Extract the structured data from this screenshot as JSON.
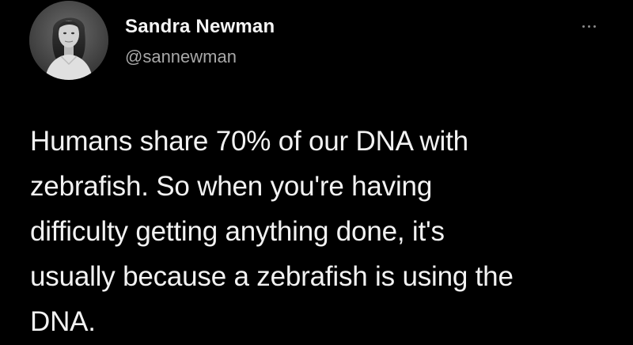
{
  "tweet": {
    "author": {
      "display_name": "Sandra Newman",
      "handle": "@sannewman",
      "avatar_icon": "profile-photo"
    },
    "more_icon": "more-options-icon",
    "text": "Humans share 70% of our DNA with\nzebrafish. So when you're having\ndifficulty getting anything done, it's\nusually because a zebrafish is using the\nDNA."
  },
  "colors": {
    "background": "#000000",
    "primary_text": "#f2f2f2",
    "secondary_text": "#a8a8a8"
  }
}
